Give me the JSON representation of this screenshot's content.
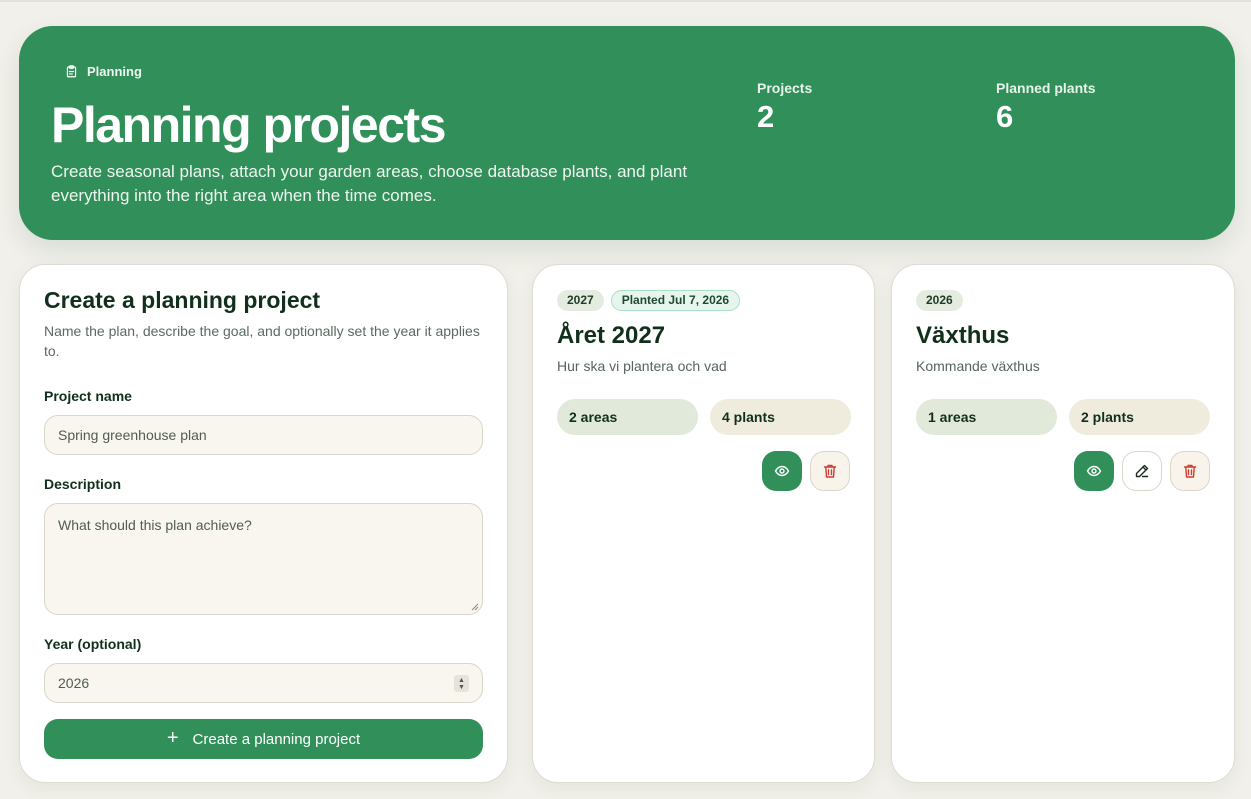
{
  "hero": {
    "badge_label": "Planning",
    "badge_icon": "clipboard-icon",
    "title": "Planning projects",
    "description": "Create seasonal plans, attach your garden areas, choose database plants, and plant everything into the right area when the time comes.",
    "stats": [
      {
        "label": "Projects",
        "value": "2"
      },
      {
        "label": "Planned plants",
        "value": "6"
      }
    ]
  },
  "form": {
    "title": "Create a planning project",
    "subtitle": "Name the plan, describe the goal, and optionally set the year it applies to.",
    "name_label": "Project name",
    "name_placeholder": "Spring greenhouse plan",
    "description_label": "Description",
    "description_placeholder": "What should this plan achieve?",
    "year_label": "Year (optional)",
    "year_value": "2026",
    "submit_label": "Create a planning project",
    "submit_icon": "plus-icon"
  },
  "projects": [
    {
      "year": "2027",
      "planted_label": "Planted Jul 7, 2026",
      "title": "Året 2027",
      "description": "Hur ska vi plantera och vad",
      "areas_label": "2 areas",
      "plants_label": "4 plants",
      "actions": [
        "view-icon",
        "trash-icon"
      ]
    },
    {
      "year": "2026",
      "title": "Växthus",
      "description": "Kommande växthus",
      "areas_label": "1 areas",
      "plants_label": "2 plants",
      "actions": [
        "view-icon",
        "pencil-icon",
        "trash-icon"
      ]
    }
  ],
  "colors": {
    "brand_green": "#318f59",
    "background": "#f1f0ea",
    "delete_red": "#d23a2f"
  }
}
